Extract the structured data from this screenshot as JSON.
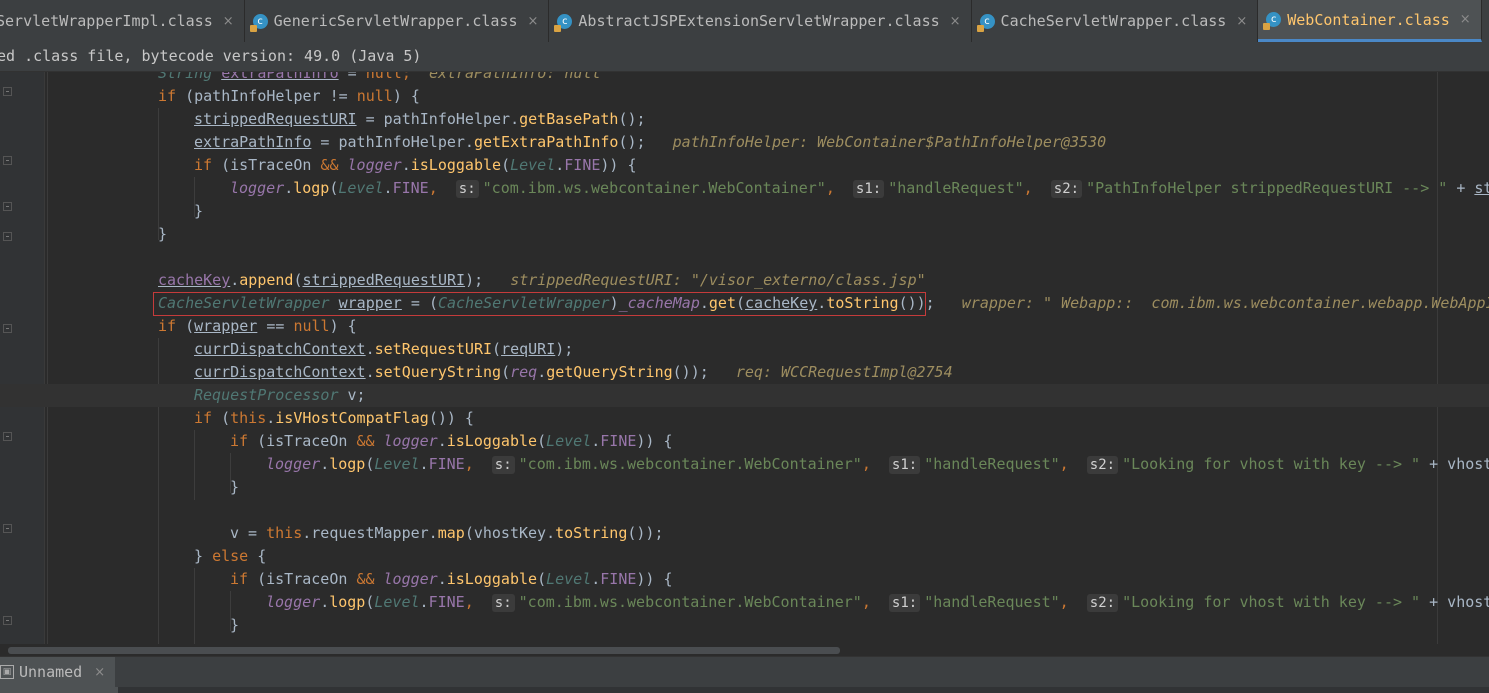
{
  "tabs": [
    {
      "label": "ServletWrapperImpl.class",
      "active": false
    },
    {
      "label": "GenericServletWrapper.class",
      "active": false
    },
    {
      "label": "AbstractJSPExtensionServletWrapper.class",
      "active": false
    },
    {
      "label": "CacheServletWrapper.class",
      "active": false
    },
    {
      "label": "WebContainer.class",
      "active": true
    }
  ],
  "tab_icon": "class-icon",
  "close_glyph": "×",
  "banner": {
    "text": "ed .class file, bytecode version: 49.0 (Java 5)"
  },
  "code": {
    "l0": {
      "a": "String",
      "b": "extraPathInfo",
      "c": " = ",
      "d": "null",
      "e": ";",
      "f": "extraPathInfo: null"
    },
    "l1": {
      "a": "if",
      "b": " (pathInfoHelper != ",
      "c": "null",
      "d": ") {"
    },
    "l2": {
      "a": "strippedRequestURI",
      "b": " = pathInfoHelper.",
      "c": "getBasePath",
      "d": "();"
    },
    "l3": {
      "a": "extraPathInfo",
      "b": " = pathInfoHelper.",
      "c": "getExtraPathInfo",
      "d": "();",
      "e": "pathInfoHelper: WebContainer$PathInfoHelper@3530"
    },
    "l4": {
      "a": "if",
      "b": " (isTraceOn ",
      "c": "&&",
      "d": "logger",
      "e": ".",
      "f": "isLoggable",
      "g": "(",
      "h": "Level",
      "i": ".",
      "j": "FINE",
      "k": ")) {"
    },
    "l5": {
      "a": "logger",
      "b": ".",
      "c": "logp",
      "d": "(",
      "e": "Level",
      "f": ".",
      "g": "FINE",
      "h": ",",
      "hs": "s:",
      "i": "\"com.ibm.ws.webcontainer.WebContainer\"",
      "j": ",",
      "hs1": "s1:",
      "k": "\"handleRequest\"",
      "l": ",",
      "hs2": "s2:",
      "m": "\"PathInfoHelper strippedRequestURI --> \"",
      "n": " + ",
      "o": "stri"
    },
    "l6": {
      "a": "}"
    },
    "l7": {
      "a": "}"
    },
    "l9": {
      "a": "cacheKey",
      "b": ".",
      "c": "append",
      "d": "(",
      "e": "strippedRequestURI",
      "f": ");",
      "g": "strippedRequestURI: \"/visor_externo/class.jsp\""
    },
    "l10": {
      "a": "CacheServletWrapper",
      "b": " ",
      "c": "wrapper",
      "d": " = ",
      "e": "(",
      "f": "CacheServletWrapper",
      "g": ")",
      "h": "_cacheMap",
      "i": ".",
      "j": "get",
      "k": "(",
      "l": "cacheKey",
      "m": ".",
      "n": "toString",
      "o": "());",
      "p": "wrapper: \" Webapp::  com.ibm.ws.webcontainer.webapp.WebAppIn"
    },
    "l11": {
      "a": "if",
      "b": " (",
      "c": "wrapper",
      "d": " == ",
      "e": "null",
      "f": ") {"
    },
    "l12": {
      "a": "currDispatchContext",
      "b": ".",
      "c": "setRequestURI",
      "d": "(",
      "e": "reqURI",
      "f": ");"
    },
    "l13": {
      "a": "currDispatchContext",
      "b": ".",
      "c": "setQueryString",
      "d": "(",
      "e": "req",
      "f": ".",
      "g": "getQueryString",
      "h": "());",
      "i": "req: WCCRequestImpl@2754"
    },
    "l14": {
      "a": "RequestProcessor",
      "b": " v;"
    },
    "l15": {
      "a": "if",
      "b": " (",
      "c": "this",
      "d": ".",
      "e": "isVHostCompatFlag",
      "f": "()) {"
    },
    "l16": {
      "a": "if",
      "b": " (isTraceOn ",
      "c": "&&",
      "d": "logger",
      "e": ".",
      "f": "isLoggable",
      "g": "(",
      "h": "Level",
      "i": ".",
      "j": "FINE",
      "k": ")) {"
    },
    "l17": {
      "a": "logger",
      "b": ".",
      "c": "logp",
      "d": "(",
      "e": "Level",
      "f": ".",
      "g": "FINE",
      "h": ",",
      "hs": "s:",
      "i": "\"com.ibm.ws.webcontainer.WebContainer\"",
      "j": ",",
      "hs1": "s1:",
      "k": "\"handleRequest\"",
      "l": ",",
      "hs2": "s2:",
      "m": "\"Looking for vhost with key --> \"",
      "n": " + vhostKe"
    },
    "l18": {
      "a": "}"
    },
    "l20": {
      "a": "v = ",
      "b": "this",
      "c": ".requestMapper.",
      "d": "map",
      "e": "(vhostKey.",
      "f": "toString",
      "g": "());"
    },
    "l21": {
      "a": "} ",
      "b": "else",
      "c": " {"
    },
    "l22": {
      "a": "if",
      "b": " (isTraceOn ",
      "c": "&&",
      "d": "logger",
      "e": ".",
      "f": "isLoggable",
      "g": "(",
      "h": "Level",
      "i": ".",
      "j": "FINE",
      "k": ")) {"
    },
    "l23": {
      "a": "logger",
      "b": ".",
      "c": "logp",
      "d": "(",
      "e": "Level",
      "f": ".",
      "g": "FINE",
      "h": ",",
      "hs": "s:",
      "i": "\"com.ibm.ws.webcontainer.WebContainer\"",
      "j": ",",
      "hs1": "s1:",
      "k": "\"handleRequest\"",
      "l": ",",
      "hs2": "s2:",
      "m": "\"Looking for vhost with key --> \"",
      "n": " + vhostKe"
    },
    "l24": {
      "a": "}"
    }
  },
  "bottom": {
    "tab_label": "Unnamed",
    "icon": "console-icon"
  },
  "colors": {
    "background": "#2b2b2b",
    "keyword": "#cc7832",
    "string": "#6a8759",
    "method": "#ffc66d",
    "field": "#9876aa",
    "highlight_box": "#c53b3b",
    "active_tab_underline": "#4a88c7"
  }
}
